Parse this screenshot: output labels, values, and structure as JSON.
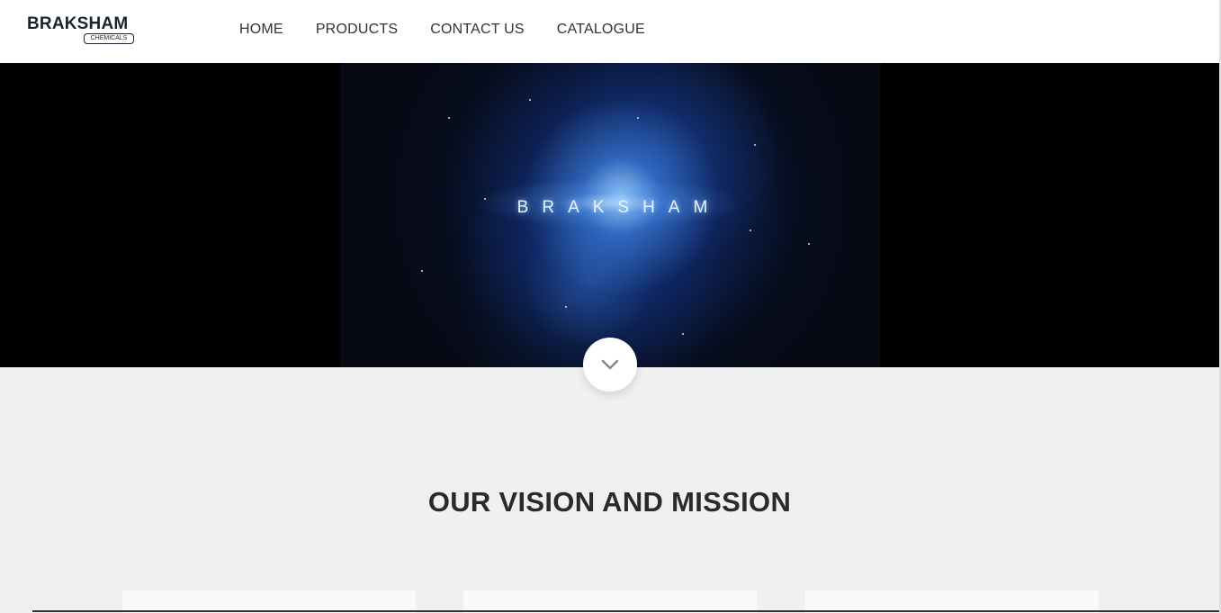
{
  "brand": {
    "name": "BRAKSHAM",
    "tagline": "CHEMICALS"
  },
  "nav": {
    "items": [
      {
        "label": "HOME"
      },
      {
        "label": "PRODUCTS"
      },
      {
        "label": "CONTACT US"
      },
      {
        "label": "CATALOGUE"
      }
    ]
  },
  "hero": {
    "video_title": "BRAKSHAM",
    "scroll_icon": "chevron-down-icon"
  },
  "section": {
    "title": "OUR VISION AND MISSION"
  },
  "colors": {
    "navbar_bg": "#ffffff",
    "hero_bg": "#000000",
    "page_bg": "#f0f0f0",
    "text": "#333333",
    "brand": "#1b2330"
  }
}
